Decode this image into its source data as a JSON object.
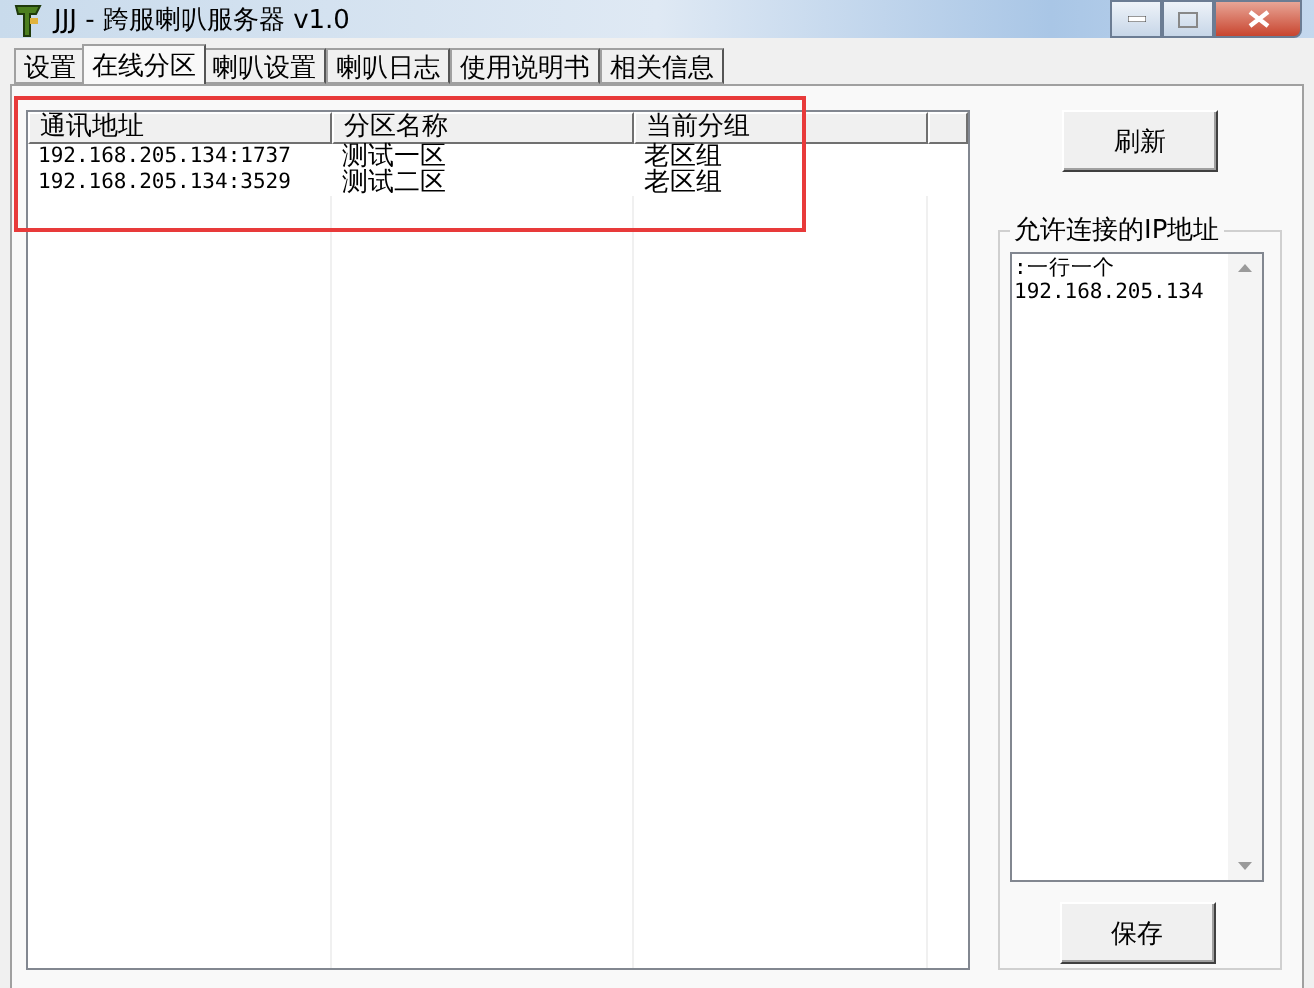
{
  "window": {
    "title": "JJJ - 跨服喇叭服务器 v1.0"
  },
  "tabs": [
    {
      "label": "设置",
      "selected": false
    },
    {
      "label": "在线分区",
      "selected": true
    },
    {
      "label": "喇叭设置",
      "selected": false
    },
    {
      "label": "喇叭日志",
      "selected": false
    },
    {
      "label": "使用说明书",
      "selected": false
    },
    {
      "label": "相关信息",
      "selected": false
    }
  ],
  "table": {
    "columns": [
      "通讯地址",
      "分区名称",
      "当前分组"
    ],
    "rows": [
      [
        "192.168.205.134:1737",
        "测试一区",
        "老区组"
      ],
      [
        "192.168.205.134:3529",
        "测试二区",
        "老区组"
      ]
    ]
  },
  "refresh_button": "刷新",
  "allowed_ips": {
    "label": "允许连接的IP地址",
    "value": ":一行一个\n192.168.205.134"
  },
  "save_button": "保存"
}
